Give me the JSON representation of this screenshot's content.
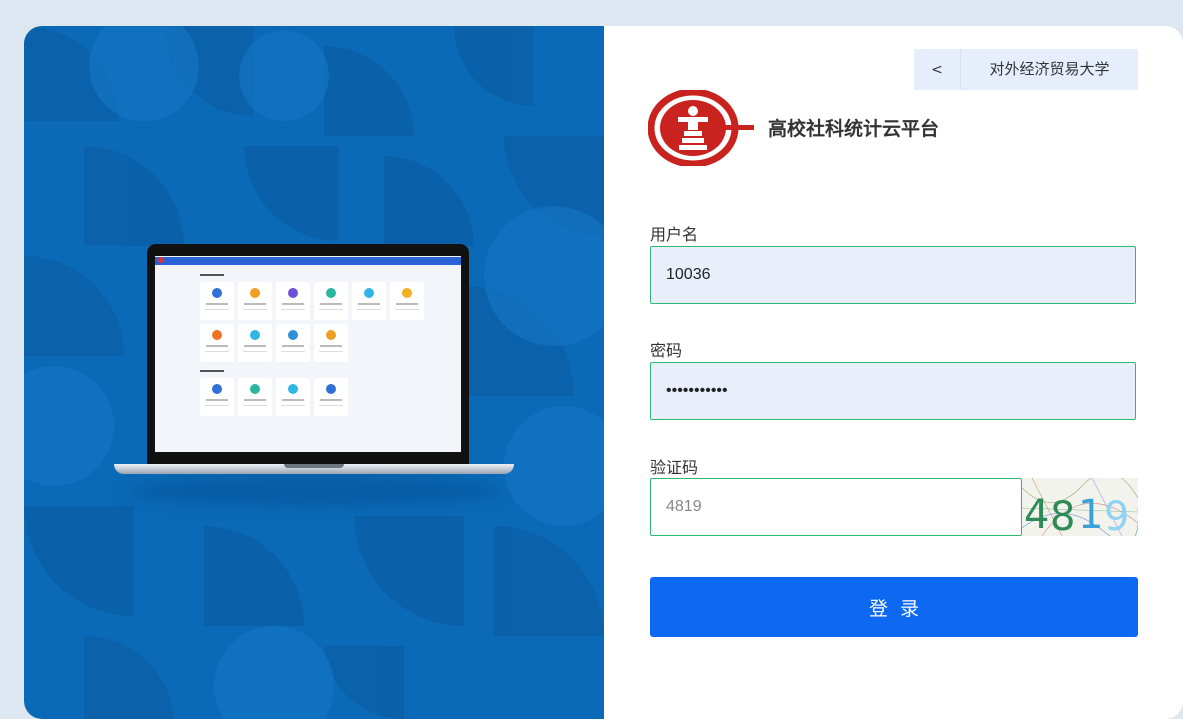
{
  "school_selector": {
    "back_label": "<",
    "school_name": "对外经济贸易大学"
  },
  "platform": {
    "title": "高校社科统计云平台"
  },
  "form": {
    "username_label": "用户名",
    "username_value": "10036",
    "password_label": "密码",
    "password_value": "•••••••••••",
    "captcha_label": "验证码",
    "captcha_value": "4819",
    "captcha_image_text": [
      "4",
      "8",
      "1",
      "9"
    ],
    "login_label": "登录"
  },
  "colors": {
    "left_panel": "#0a6ab8",
    "accent": "#0d68f2",
    "field_border": "#2fb873",
    "field_bg": "#e8effb"
  }
}
